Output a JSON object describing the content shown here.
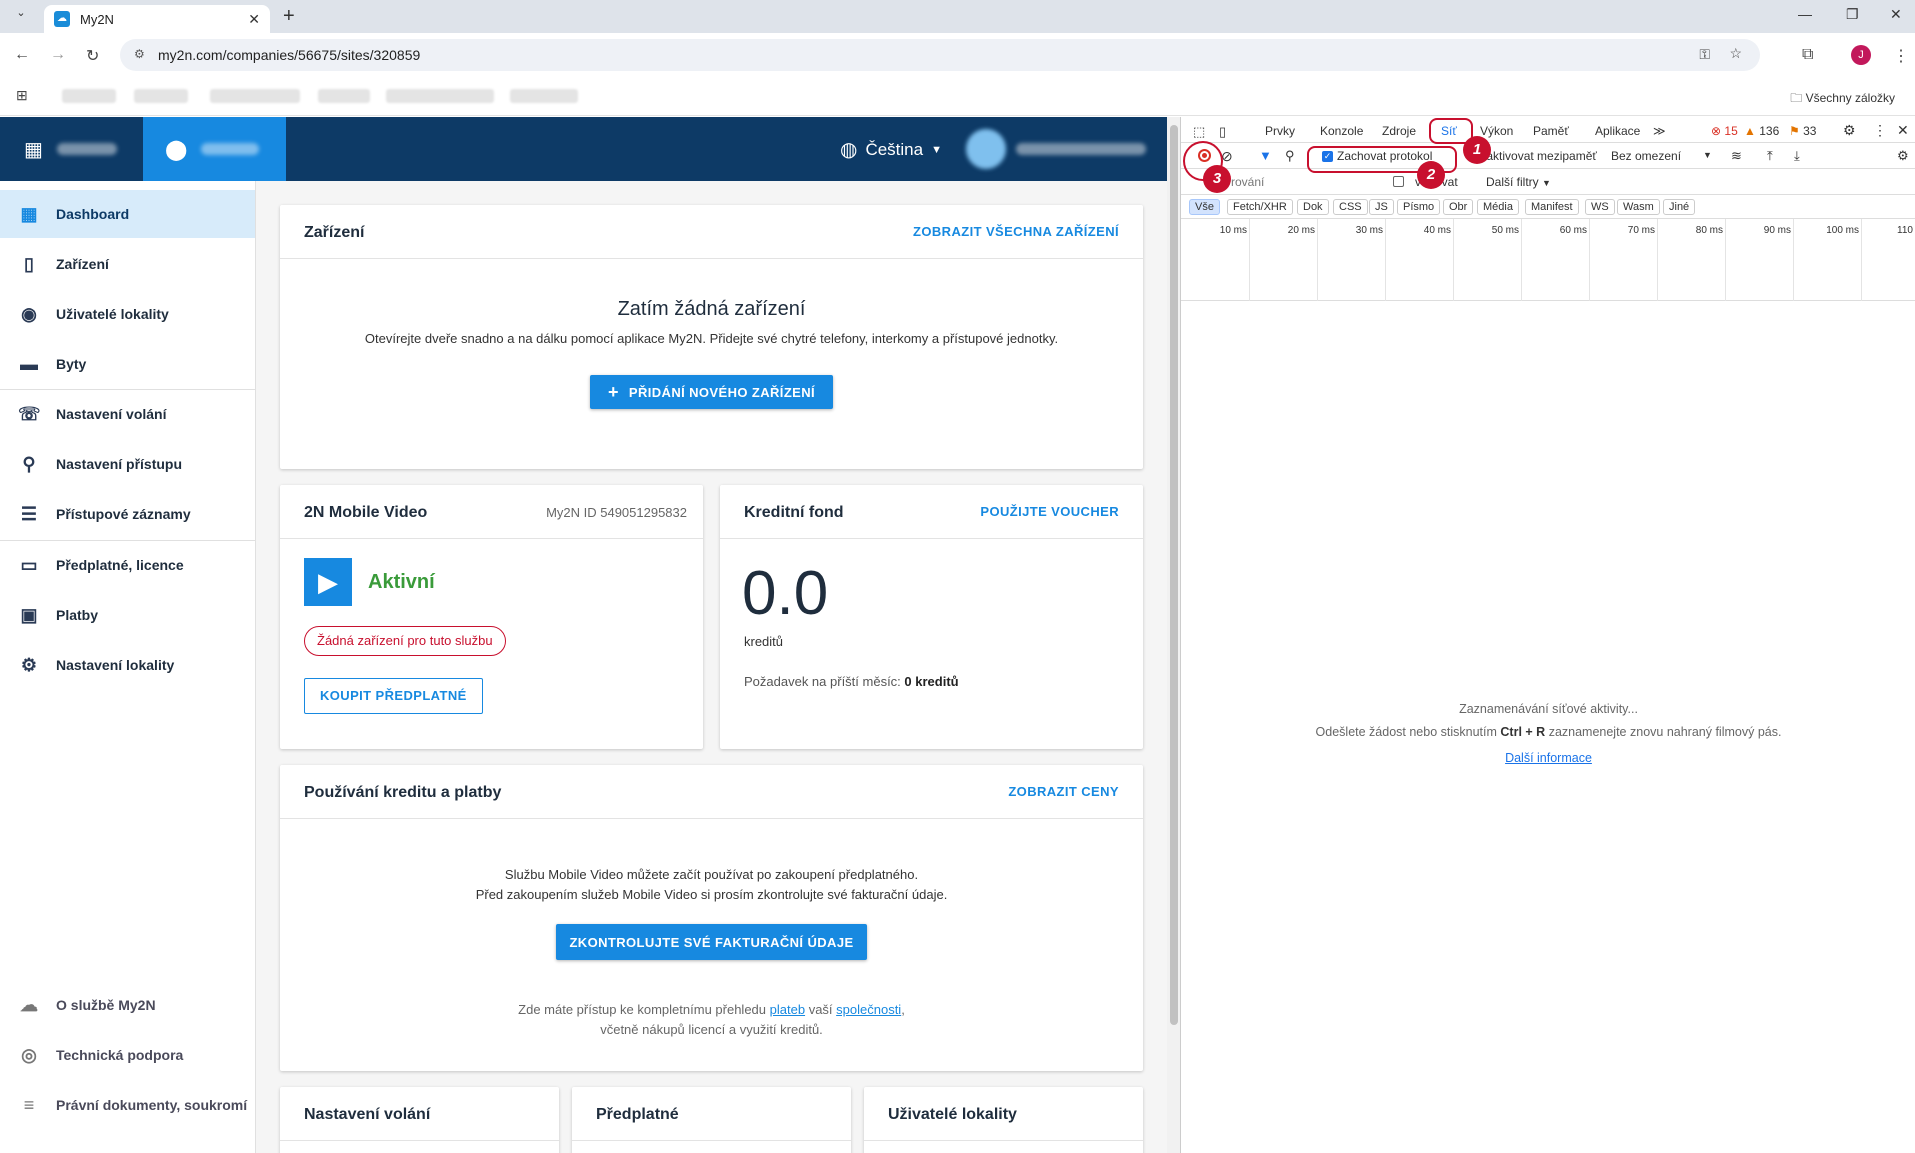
{
  "browser": {
    "tab_title": "My2N",
    "url": "my2n.com/companies/56675/sites/320859",
    "all_bookmarks": "Všechny záložky"
  },
  "header": {
    "language": "Čeština"
  },
  "sidebar": {
    "items": [
      {
        "label": "Dashboard",
        "icon": "dashboard-icon"
      },
      {
        "label": "Zařízení",
        "icon": "device-icon"
      },
      {
        "label": "Uživatelé lokality",
        "icon": "users-icon"
      },
      {
        "label": "Byty",
        "icon": "folder-icon"
      },
      {
        "label": "Nastavení volání",
        "icon": "phone-settings-icon"
      },
      {
        "label": "Nastavení přístupu",
        "icon": "access-icon"
      },
      {
        "label": "Přístupové záznamy",
        "icon": "list-icon"
      },
      {
        "label": "Předplatné, licence",
        "icon": "card-icon"
      },
      {
        "label": "Platby",
        "icon": "payments-icon"
      },
      {
        "label": "Nastavení lokality",
        "icon": "gear-icon"
      }
    ],
    "bottom_items": [
      {
        "label": "O službě My2N",
        "icon": "cloud-icon"
      },
      {
        "label": "Technická podpora",
        "icon": "support-icon"
      },
      {
        "label": "Právní dokumenty, soukromí",
        "icon": "legal-icon"
      }
    ]
  },
  "main": {
    "devices": {
      "title": "Zařízení",
      "link": "ZOBRAZIT VŠECHNA ZAŘÍZENÍ",
      "empty_title": "Zatím žádná zařízení",
      "empty_text": "Otevírejte dveře snadno a na dálku pomocí aplikace My2N. Přidejte své chytré telefony, interkomy a přístupové jednotky.",
      "add_button": "PŘIDÁNÍ NOVÉHO ZAŘÍZENÍ"
    },
    "mobile_video": {
      "title": "2N Mobile Video",
      "my2n_id": "My2N ID 549051295832",
      "status": "Aktivní",
      "warning": "Žádná zařízení pro tuto službu",
      "buy_button": "KOUPIT PŘEDPLATNÉ"
    },
    "credit": {
      "title": "Kreditní fond",
      "link": "POUŽIJTE VOUCHER",
      "value": "0.0",
      "unit": "kreditů",
      "next_month_label": "Požadavek na příští měsíc:",
      "next_month_value": "0 kreditů"
    },
    "usage": {
      "title": "Používání kreditu a platby",
      "link": "ZOBRAZIT CENY",
      "line1": "Službu Mobile Video můžete začít používat po zakoupení předplatného.",
      "line2": "Před zakoupením služeb Mobile Video si prosím zkontrolujte své fakturační údaje.",
      "check_button": "ZKONTROLUJTE SVÉ FAKTURAČNÍ ÚDAJE",
      "footer_pre": "Zde máte přístup ke kompletnímu přehledu",
      "footer_link1": "plateb",
      "footer_mid": "vaší",
      "footer_link2": "společnosti",
      "footer_post": ",",
      "footer_line2": "včetně nákupů licencí a využití kreditů."
    },
    "bottom_cards": [
      "Nastavení volání",
      "Předplatné",
      "Uživatelé lokality"
    ]
  },
  "devtools": {
    "tabs": [
      "Prvky",
      "Konzole",
      "Zdroje",
      "Síť",
      "Výkon",
      "Paměť",
      "Aplikace"
    ],
    "selected_tab": "Síť",
    "errors": "15",
    "warnings": "136",
    "issues": "33",
    "preserve_log": "Zachovat protokol",
    "disable_cache": "Deaktivovat mezipaměť",
    "throttle": "Bez omezení",
    "filter_placeholder": "rování",
    "invert": "vertovat",
    "more_filters": "Další filtry",
    "types": [
      "Vše",
      "Fetch/XHR",
      "Dok",
      "CSS",
      "JS",
      "Písmo",
      "Obr",
      "Média",
      "Manifest",
      "WS",
      "Wasm",
      "Jiné"
    ],
    "timeline_ticks": [
      "10 ms",
      "20 ms",
      "30 ms",
      "40 ms",
      "50 ms",
      "60 ms",
      "70 ms",
      "80 ms",
      "90 ms",
      "100 ms",
      "110"
    ],
    "empty_line1": "Zaznamenávání síťové aktivity...",
    "empty_line2_pre": "Odešlete žádost nebo stisknutím",
    "empty_line2_keys": "Ctrl + R",
    "empty_line2_post": "zaznamenejte znovu nahraný filmový pás.",
    "more_info": "Další informace",
    "annotations": [
      "1",
      "2",
      "3"
    ]
  },
  "colors": {
    "header_bg": "#0d3a66",
    "accent": "#1789e0",
    "active_green": "#3a9b3a",
    "annotation_red": "#c8102e"
  }
}
